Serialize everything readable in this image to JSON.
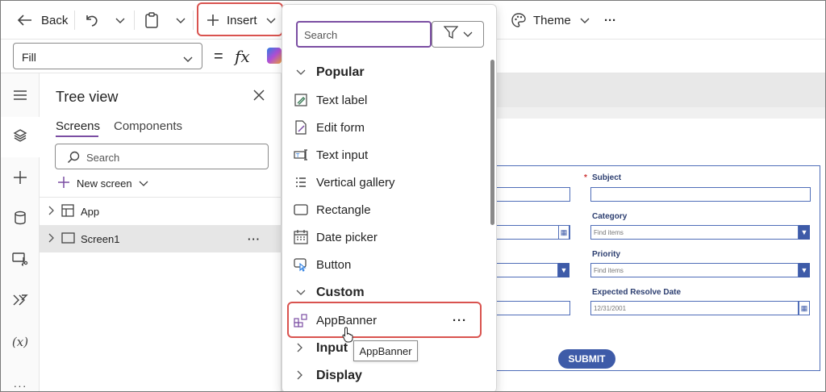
{
  "toolbar": {
    "back_label": "Back",
    "insert_label": "Insert",
    "theme_label": "Theme",
    "more_label": "···"
  },
  "formula_bar": {
    "property_value": "Fill",
    "fx_label": "fx",
    "equals": "="
  },
  "tree_view": {
    "title": "Tree view",
    "tabs": [
      "Screens",
      "Components"
    ],
    "search_placeholder": "Search",
    "new_screen_label": "New screen",
    "items": [
      {
        "label": "App"
      },
      {
        "label": "Screen1",
        "more": "···"
      }
    ]
  },
  "insert_panel": {
    "search_placeholder": "Search",
    "categories": {
      "popular": "Popular",
      "custom": "Custom",
      "input": "Input",
      "display": "Display"
    },
    "popular_items": [
      {
        "label": "Text label",
        "icon": "text-label-icon"
      },
      {
        "label": "Edit form",
        "icon": "edit-form-icon"
      },
      {
        "label": "Text input",
        "icon": "text-input-icon"
      },
      {
        "label": "Vertical gallery",
        "icon": "vertical-gallery-icon"
      },
      {
        "label": "Rectangle",
        "icon": "rectangle-icon"
      },
      {
        "label": "Date picker",
        "icon": "date-picker-icon"
      },
      {
        "label": "Button",
        "icon": "button-icon"
      }
    ],
    "custom_items": [
      {
        "label": "AppBanner",
        "icon": "component-icon",
        "more": "···"
      }
    ],
    "tooltip": "AppBanner"
  },
  "form": {
    "subject_label": "Subject",
    "required_mark": "*",
    "category_label": "Category",
    "category_placeholder": "Find items",
    "priority_label": "Priority",
    "priority_placeholder": "Find items",
    "resolve_label": "Expected Resolve Date",
    "resolve_value": "12/31/2001",
    "submit_label": "SUBMIT"
  },
  "colors": {
    "accent_purple": "#7b4ea3",
    "highlight_red": "#d9534f",
    "form_blue": "#3e5ba8"
  }
}
